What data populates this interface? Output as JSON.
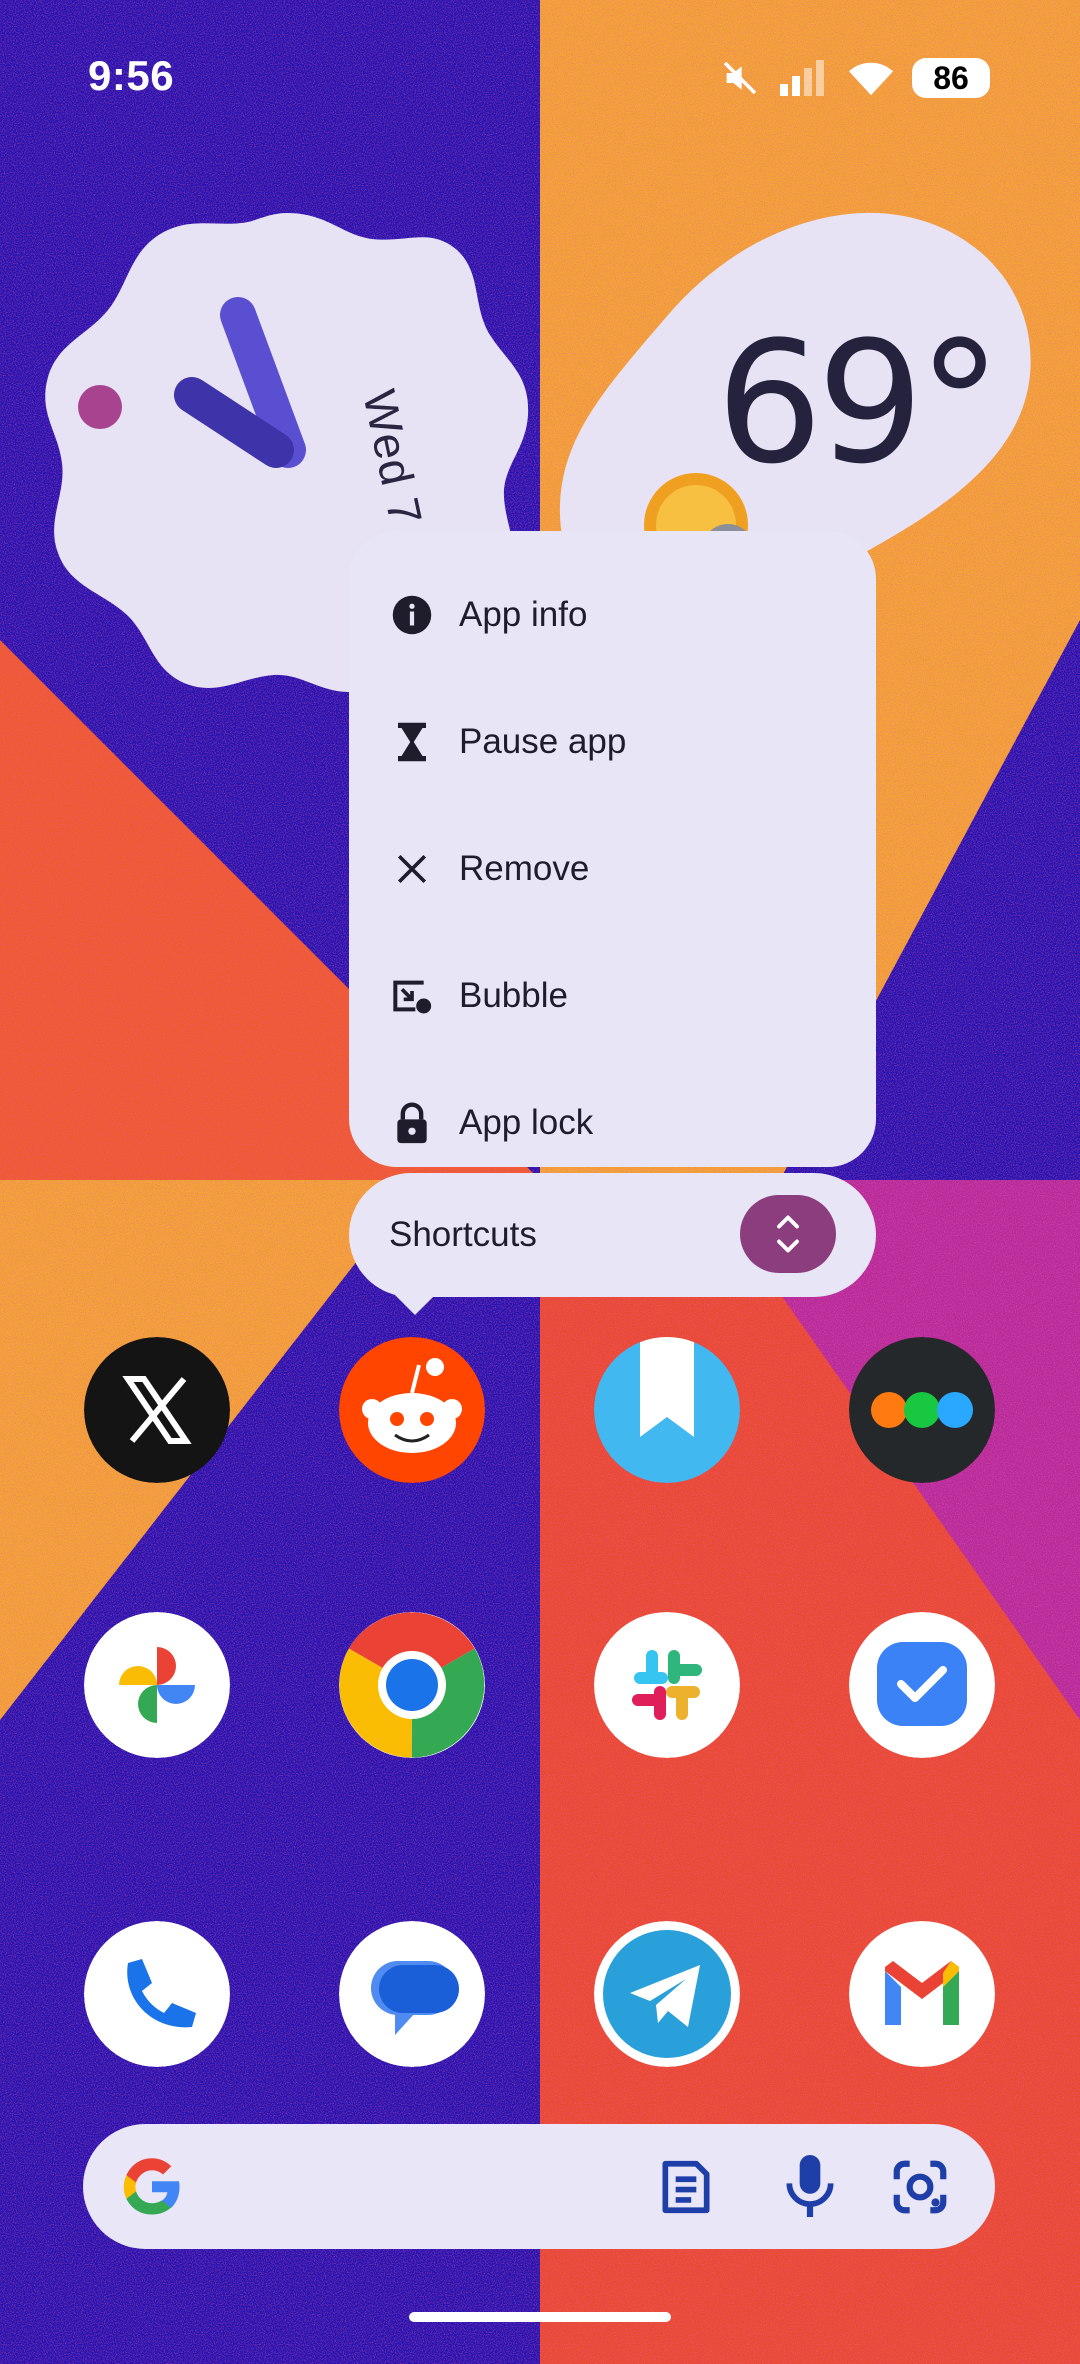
{
  "status_bar": {
    "time": "9:56",
    "battery": "86",
    "icons": [
      "mute-icon",
      "signal-icon",
      "wifi-icon",
      "battery-icon"
    ]
  },
  "clock_widget": {
    "date": "Wed 7"
  },
  "weather_widget": {
    "temperature": "69°",
    "condition_icon": "partly-sunny-icon"
  },
  "context_menu": {
    "items": [
      {
        "label": "App info",
        "icon": "info-icon"
      },
      {
        "label": "Pause app",
        "icon": "hourglass-icon"
      },
      {
        "label": "Remove",
        "icon": "close-icon"
      },
      {
        "label": "Bubble",
        "icon": "bubble-icon"
      },
      {
        "label": "App lock",
        "icon": "lock-icon"
      }
    ],
    "shortcuts_label": "Shortcuts",
    "shortcuts_toggle_icon": "expand-icon"
  },
  "apps": [
    {
      "name": "X",
      "icon": "x-app-icon"
    },
    {
      "name": "Reddit",
      "icon": "reddit-app-icon"
    },
    {
      "name": "Bookmark",
      "icon": "bookmark-app-icon"
    },
    {
      "name": "Dots",
      "icon": "dots-app-icon"
    },
    {
      "name": "Photos",
      "icon": "photos-app-icon"
    },
    {
      "name": "Chrome",
      "icon": "chrome-app-icon"
    },
    {
      "name": "Slack",
      "icon": "slack-app-icon"
    },
    {
      "name": "Tasks",
      "icon": "tasks-app-icon"
    },
    {
      "name": "Phone",
      "icon": "phone-app-icon"
    },
    {
      "name": "Messages",
      "icon": "messages-app-icon"
    },
    {
      "name": "Telegram",
      "icon": "telegram-app-icon"
    },
    {
      "name": "Gmail",
      "icon": "gmail-app-icon"
    }
  ],
  "search_bar": {
    "icons": [
      "google-icon",
      "news-icon",
      "mic-icon",
      "lens-icon"
    ]
  },
  "colors": {
    "wallpaper_blue": "#1a0ea8",
    "wallpaper_orange": "#f0a530",
    "wallpaper_red": "#e8462e",
    "menu_bg": "#e8e5f6",
    "accent": "#8b3d7e"
  }
}
